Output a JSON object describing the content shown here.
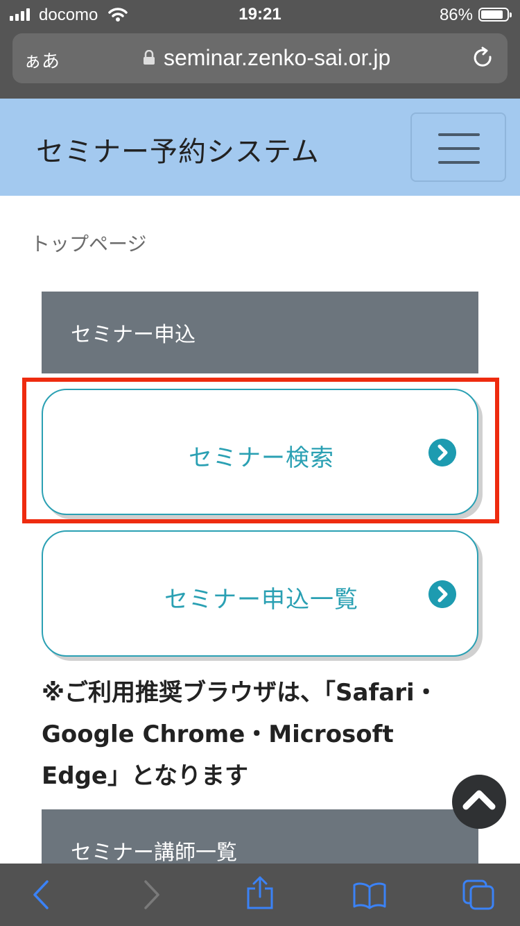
{
  "status_bar": {
    "carrier": "docomo",
    "time": "19:21",
    "battery_percent": "86%",
    "battery_level": 0.86
  },
  "browser": {
    "text_size_label": "ぁあ",
    "url": "seminar.zenko-sai.or.jp"
  },
  "site": {
    "title": "セミナー予約システム"
  },
  "breadcrumb": "トップページ",
  "sections": {
    "apply_heading": "セミナー申込",
    "lecturer_heading": "セミナー講師一覧"
  },
  "menu": {
    "search_label": "セミナー検索",
    "apply_list_label": "セミナー申込一覧"
  },
  "note": {
    "line1": "※ご利用推奨ブラウザは、「Safari・",
    "line2": "Google Chrome・Microsoft",
    "line3": "Edge」となります"
  },
  "colors": {
    "header_bg": "#a3c9ef",
    "section_bg": "#6c757d",
    "accent_teal": "#2aa0b3",
    "highlight_red": "#ee2b0f"
  },
  "icons": [
    "signal-icon",
    "wifi-icon",
    "battery-icon",
    "lock-icon",
    "reload-icon",
    "menu-icon",
    "chevron-right-circle-icon",
    "chevron-up-icon",
    "back-icon",
    "forward-icon",
    "share-icon",
    "bookmarks-icon",
    "tabs-icon"
  ]
}
